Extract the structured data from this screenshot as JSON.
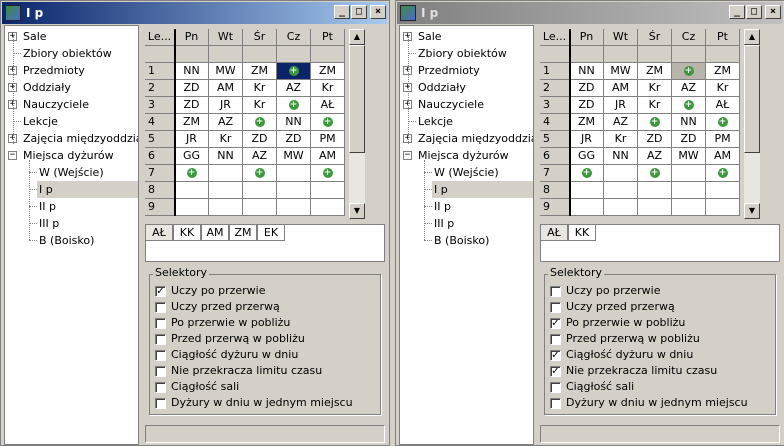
{
  "windows": [
    {
      "title": "I p",
      "active": true,
      "tree": [
        {
          "label": "Sale",
          "expander": "+"
        },
        {
          "label": "Zbiory obiektów",
          "expander": ""
        },
        {
          "label": "Przedmioty",
          "expander": "+"
        },
        {
          "label": "Oddziały",
          "expander": "+"
        },
        {
          "label": "Nauczyciele",
          "expander": "+"
        },
        {
          "label": "Lekcje",
          "expander": ""
        },
        {
          "label": "Zajęcia międzyoddziało",
          "expander": "+"
        },
        {
          "label": "Miejsca dyżurów",
          "expander": "-"
        }
      ],
      "tree_children": [
        {
          "label": "W (Wejście)",
          "selected": false
        },
        {
          "label": "I p",
          "selected": true
        },
        {
          "label": "II p",
          "selected": false
        },
        {
          "label": "III p",
          "selected": false
        },
        {
          "label": "B (Boisko)",
          "selected": false
        }
      ],
      "grid_headers": [
        "Le...",
        "Pn",
        "Wt",
        "Śr",
        "Cz",
        "Pt"
      ],
      "grid_rows": [
        [
          "",
          "",
          "",
          "",
          "",
          ""
        ],
        [
          "1",
          "NN",
          "MW",
          "ZM",
          "+",
          "ZM"
        ],
        [
          "2",
          "ZD",
          "AM",
          "Kr",
          "AZ",
          "Kr"
        ],
        [
          "3",
          "ZD",
          "JR",
          "Kr",
          "+",
          "AŁ"
        ],
        [
          "4",
          "ZM",
          "AZ",
          "+",
          "NN",
          "+"
        ],
        [
          "5",
          "JR",
          "Kr",
          "ZD",
          "ZD",
          "PM"
        ],
        [
          "6",
          "GG",
          "NN",
          "AZ",
          "MW",
          "AM"
        ],
        [
          "7",
          "+",
          "",
          "+",
          "",
          "+"
        ],
        [
          "8",
          "",
          "",
          "",
          "",
          ""
        ],
        [
          "9",
          "",
          "",
          "",
          "",
          ""
        ]
      ],
      "selected_cell": [
        1,
        4
      ],
      "tabs": [
        "AŁ",
        "KK",
        "AM",
        "ZM",
        "EK"
      ],
      "selectors_title": "Selektory",
      "selectors": [
        {
          "label": "Uczy po przerwie",
          "checked": true
        },
        {
          "label": "Uczy przed przerwą",
          "checked": false
        },
        {
          "label": "Po przerwie w pobliżu",
          "checked": false
        },
        {
          "label": "Przed przerwą w pobliżu",
          "checked": false
        },
        {
          "label": "Ciągłość dyżuru w dniu",
          "checked": false
        },
        {
          "label": "Nie przekracza limitu czasu",
          "checked": false
        },
        {
          "label": "Ciągłość sali",
          "checked": false
        },
        {
          "label": "Dyżury w dniu w jednym miejscu",
          "checked": false
        }
      ]
    },
    {
      "title": "I p",
      "active": false,
      "tree": [
        {
          "label": "Sale",
          "expander": "+"
        },
        {
          "label": "Zbiory obiektów",
          "expander": ""
        },
        {
          "label": "Przedmioty",
          "expander": "+"
        },
        {
          "label": "Oddziały",
          "expander": "+"
        },
        {
          "label": "Nauczyciele",
          "expander": "+"
        },
        {
          "label": "Lekcje",
          "expander": ""
        },
        {
          "label": "Zajęcia międzyoddziało",
          "expander": "+"
        },
        {
          "label": "Miejsca dyżurów",
          "expander": "-"
        }
      ],
      "tree_children": [
        {
          "label": "W (Wejście)",
          "selected": false
        },
        {
          "label": "I p",
          "selected": true
        },
        {
          "label": "II p",
          "selected": false
        },
        {
          "label": "III p",
          "selected": false
        },
        {
          "label": "B (Boisko)",
          "selected": false
        }
      ],
      "grid_headers": [
        "Le...",
        "Pn",
        "Wt",
        "Śr",
        "Cz",
        "Pt"
      ],
      "grid_rows": [
        [
          "",
          "",
          "",
          "",
          "",
          ""
        ],
        [
          "1",
          "NN",
          "MW",
          "ZM",
          "+",
          "ZM"
        ],
        [
          "2",
          "ZD",
          "AM",
          "Kr",
          "AZ",
          "Kr"
        ],
        [
          "3",
          "ZD",
          "JR",
          "Kr",
          "+",
          "AŁ"
        ],
        [
          "4",
          "ZM",
          "AZ",
          "+",
          "NN",
          "+"
        ],
        [
          "5",
          "JR",
          "Kr",
          "ZD",
          "ZD",
          "PM"
        ],
        [
          "6",
          "GG",
          "NN",
          "AZ",
          "MW",
          "AM"
        ],
        [
          "7",
          "+",
          "",
          "+",
          "",
          "+"
        ],
        [
          "8",
          "",
          "",
          "",
          "",
          ""
        ],
        [
          "9",
          "",
          "",
          "",
          "",
          ""
        ]
      ],
      "selected_cell": [
        1,
        4
      ],
      "tabs": [
        "AŁ",
        "KK"
      ],
      "selectors_title": "Selektory",
      "selectors": [
        {
          "label": "Uczy po przerwie",
          "checked": false
        },
        {
          "label": "Uczy przed przerwą",
          "checked": false
        },
        {
          "label": "Po przerwie w pobliżu",
          "checked": true
        },
        {
          "label": "Przed przerwą w pobliżu",
          "checked": false
        },
        {
          "label": "Ciągłość dyżuru w dniu",
          "checked": true
        },
        {
          "label": "Nie przekracza limitu czasu",
          "checked": true
        },
        {
          "label": "Ciągłość sali",
          "checked": false
        },
        {
          "label": "Dyżury w dniu w jednym miejscu",
          "checked": false
        }
      ]
    }
  ],
  "icons": {
    "minimize": "minimize-icon",
    "maximize": "maximize-icon",
    "close": "close-icon",
    "add": "green-plus-icon"
  },
  "colors": {
    "active_title": "#0a246a",
    "inactive_title": "#808080",
    "plus_green": "#3a9a3a",
    "face": "#d4d0c8"
  }
}
